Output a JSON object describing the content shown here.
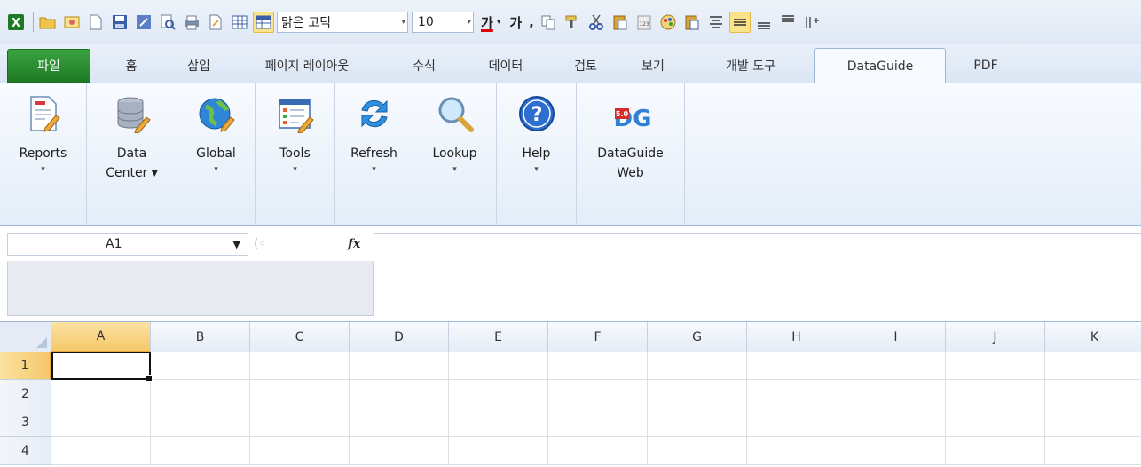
{
  "quick_access": {
    "font_name": "맑은 고딕",
    "font_size": "10",
    "font_color_glyph": "가",
    "font_glyph": "가",
    "comma_glyph": ","
  },
  "tabs": [
    {
      "label": "파일",
      "id": "file"
    },
    {
      "label": "홈",
      "id": "home"
    },
    {
      "label": "삽입",
      "id": "insert"
    },
    {
      "label": "페이지 레이아웃",
      "id": "page-layout"
    },
    {
      "label": "수식",
      "id": "formulas"
    },
    {
      "label": "데이터",
      "id": "data"
    },
    {
      "label": "검토",
      "id": "review"
    },
    {
      "label": "보기",
      "id": "view"
    },
    {
      "label": "개발 도구",
      "id": "developer"
    },
    {
      "label": "DataGuide",
      "id": "dataguide",
      "selected": true
    },
    {
      "label": "PDF",
      "id": "pdf"
    }
  ],
  "ribbon": {
    "buttons": [
      {
        "label1": "Reports",
        "label2": "",
        "dropdown": true,
        "icon": "reports-icon"
      },
      {
        "label1": "Data",
        "label2": "Center ▾",
        "dropdown": false,
        "icon": "database-icon"
      },
      {
        "label1": "Global",
        "label2": "",
        "dropdown": true,
        "icon": "globe-icon"
      },
      {
        "label1": "Tools",
        "label2": "",
        "dropdown": true,
        "icon": "tools-icon"
      },
      {
        "label1": "Refresh",
        "label2": "",
        "dropdown": true,
        "icon": "refresh-icon"
      },
      {
        "label1": "Lookup",
        "label2": "",
        "dropdown": true,
        "icon": "magnifier-icon"
      },
      {
        "label1": "Help",
        "label2": "",
        "dropdown": true,
        "icon": "help-icon"
      },
      {
        "label1": "DataGuide",
        "label2": "Web",
        "dropdown": false,
        "icon": "dataguide-logo-icon"
      }
    ],
    "dataguide_version": "5.0",
    "dataguide_logo_text": "DG"
  },
  "formula_bar": {
    "name_box": "A1",
    "fx_label": "fx",
    "formula_value": ""
  },
  "grid": {
    "columns": [
      "A",
      "B",
      "C",
      "D",
      "E",
      "F",
      "G",
      "H",
      "I",
      "J",
      "K"
    ],
    "rows": [
      "1",
      "2",
      "3",
      "4"
    ],
    "active_cell": "A1"
  },
  "colors": {
    "file_tab": "#2a8a30",
    "selection_header": "#f5c86a",
    "ribbon_border": "#9eb6d6"
  }
}
